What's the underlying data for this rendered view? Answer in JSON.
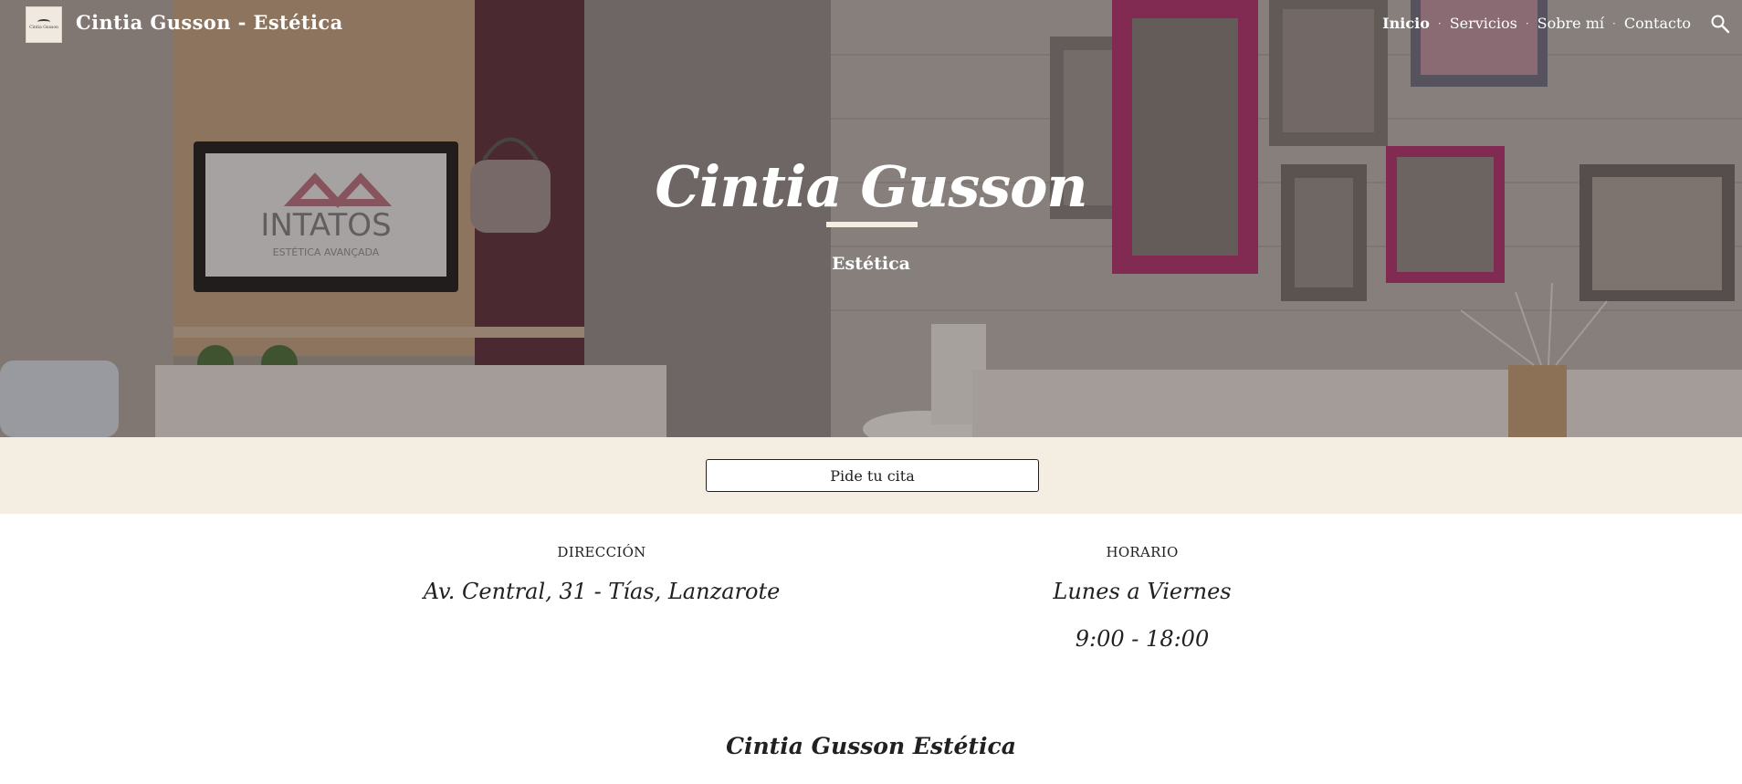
{
  "header": {
    "logo_text": "Cintia Gusson",
    "site_title": "Cintia Gusson - Estética",
    "nav": [
      {
        "label": "Inicio",
        "active": true
      },
      {
        "label": "Servicios"
      },
      {
        "label": "Sobre mí"
      },
      {
        "label": "Contacto"
      }
    ],
    "nav_separator": "·",
    "search_icon": "search-icon"
  },
  "hero": {
    "title": "Cintia Gusson",
    "subtitle": "Estética",
    "photo_tv_text": "INTATOS",
    "photo_tv_subtext": "ESTÉTICA AVANÇADA"
  },
  "cta": {
    "label": "Pide tu cita"
  },
  "info": {
    "address_label": "DIRECCIÓN",
    "address_value": "Av. Central, 31 - Tías, Lanzarote",
    "hours_label": "HORARIO",
    "hours_days": "Lunes a Viernes",
    "hours_time": "9:00 - 18:00"
  },
  "about": {
    "title": "Cintia Gusson Estética"
  },
  "colors": {
    "band": "#f4ede1",
    "text": "#212121",
    "accent_frame": "#a8306a"
  }
}
